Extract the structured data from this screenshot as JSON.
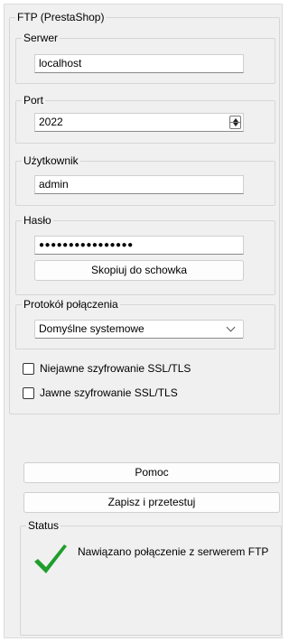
{
  "ftp_group": {
    "title": "FTP (PrestaShop)"
  },
  "server": {
    "label": "Serwer",
    "value": "localhost"
  },
  "port": {
    "label": "Port",
    "value": "2022"
  },
  "user": {
    "label": "Użytkownik",
    "value": "admin"
  },
  "password": {
    "label": "Hasło",
    "value": "●●●●●●●●●●●●●●●●",
    "copy_button": "Skopiuj do schowka"
  },
  "protocol": {
    "label": "Protokół połączenia",
    "selected": "Domyślne systemowe"
  },
  "options": {
    "implicit_ssl": {
      "label": "Niejawne szyfrowanie SSL/TLS",
      "checked": false
    },
    "explicit_ssl": {
      "label": "Jawne szyfrowanie SSL/TLS",
      "checked": false
    }
  },
  "buttons": {
    "help": "Pomoc",
    "save_test": "Zapisz i przetestuj"
  },
  "status": {
    "label": "Status",
    "message": "Nawiązano połączenie z serwerem FTP",
    "icon": "checkmark-icon",
    "icon_color": "#1f9e2c"
  }
}
